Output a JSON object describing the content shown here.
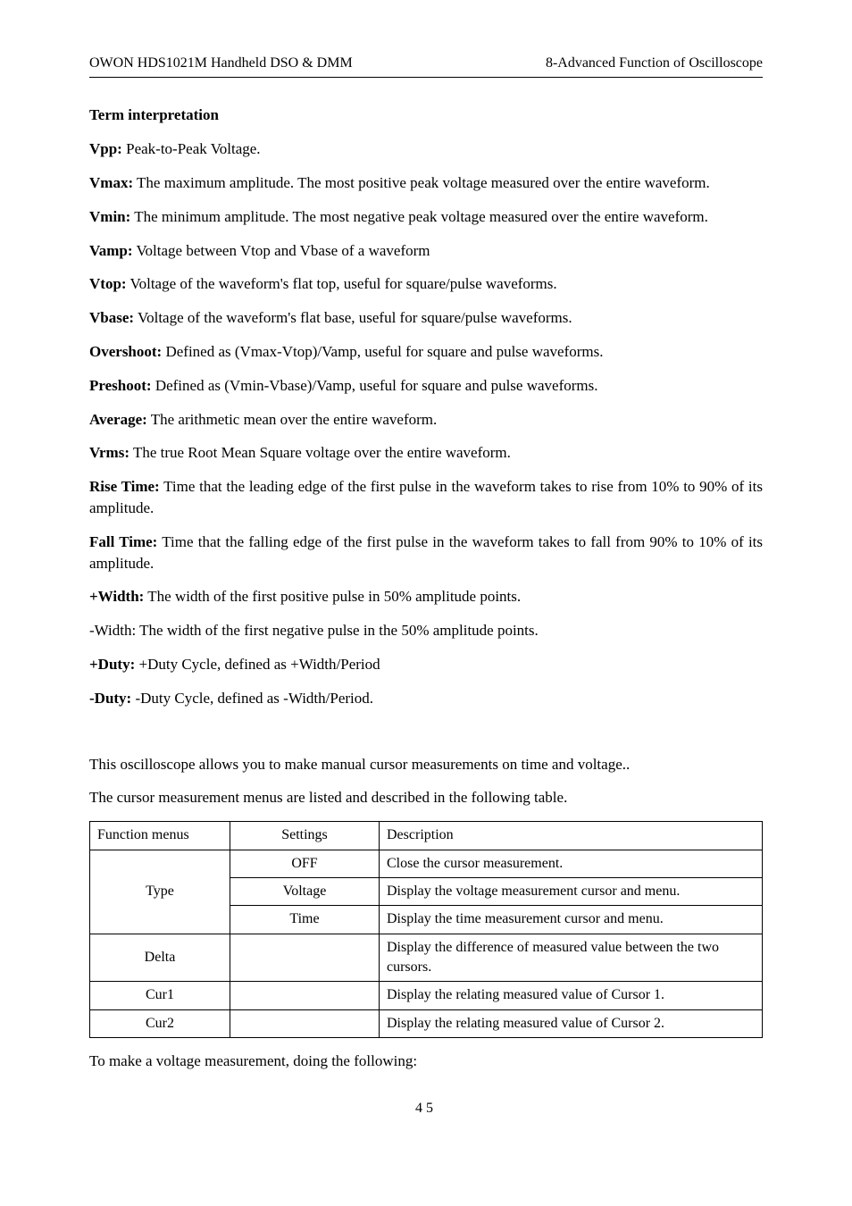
{
  "header": {
    "left": "OWON    HDS1021M Handheld DSO & DMM",
    "right": "8-Advanced Function of Oscilloscope"
  },
  "sectionTitle": "Term interpretation",
  "terms": [
    {
      "label": "Vpp:",
      "text": " Peak-to-Peak Voltage."
    },
    {
      "label": "Vmax:",
      "text": " The maximum amplitude. The most positive peak voltage measured over the entire waveform."
    },
    {
      "label": "Vmin:",
      "text": " The minimum amplitude. The most negative peak voltage measured over the entire waveform."
    },
    {
      "label": "Vamp:",
      "text": " Voltage between Vtop and Vbase of a waveform"
    },
    {
      "label": "Vtop:",
      "text": " Voltage of the waveform's flat top, useful for square/pulse waveforms."
    },
    {
      "label": "Vbase:",
      "text": " Voltage of the waveform's flat base, useful for square/pulse waveforms."
    },
    {
      "label": "Overshoot:",
      "text": " Defined as (Vmax-Vtop)/Vamp, useful for square and pulse waveforms."
    },
    {
      "label": "Preshoot:",
      "text": " Defined as (Vmin-Vbase)/Vamp, useful for square and pulse waveforms."
    },
    {
      "label": "Average:",
      "text": " The arithmetic mean over the entire waveform."
    },
    {
      "label": "Vrms:",
      "text": " The true Root Mean Square voltage over the entire waveform."
    },
    {
      "label": "Rise Time:",
      "text": " Time that the leading edge of the first pulse in the waveform takes to rise from 10% to 90% of its amplitude."
    },
    {
      "label": "Fall Time:",
      "text": " Time that the falling edge of the first pulse in the waveform takes to fall from 90% to 10% of its amplitude."
    },
    {
      "label": "+Width:",
      "text": " The width of the first positive pulse in 50% amplitude points."
    },
    {
      "label": "",
      "text": "-Width: The width of the first negative pulse in the 50% amplitude points."
    },
    {
      "label": "+Duty:",
      "text": " +Duty Cycle, defined as +Width/Period"
    },
    {
      "label": "-Duty:",
      "text": " -Duty Cycle, defined as -Width/Period."
    }
  ],
  "intro1": "This oscilloscope allows you to make manual cursor measurements on time and voltage..",
  "intro2": "The cursor measurement menus are listed and described in the following table.",
  "table": {
    "headers": [
      "Function menus",
      "Settings",
      "Description"
    ],
    "typeRow": {
      "label": "Type",
      "rows": [
        {
          "setting": "OFF",
          "desc": "Close the cursor measurement."
        },
        {
          "setting": "Voltage",
          "desc": "Display the voltage measurement cursor and menu."
        },
        {
          "setting": "Time",
          "desc": "Display the time measurement cursor and menu."
        }
      ]
    },
    "delta": {
      "label": "Delta",
      "setting": "",
      "desc": "Display the difference of measured value between the two cursors."
    },
    "cur1": {
      "label": "Cur1",
      "setting": "",
      "desc": "Display the relating measured value of Cursor 1."
    },
    "cur2": {
      "label": "Cur2",
      "setting": "",
      "desc": "Display the relating measured value of Cursor 2."
    }
  },
  "closing": "To make a voltage measurement, doing the following:",
  "pageNum": "45"
}
